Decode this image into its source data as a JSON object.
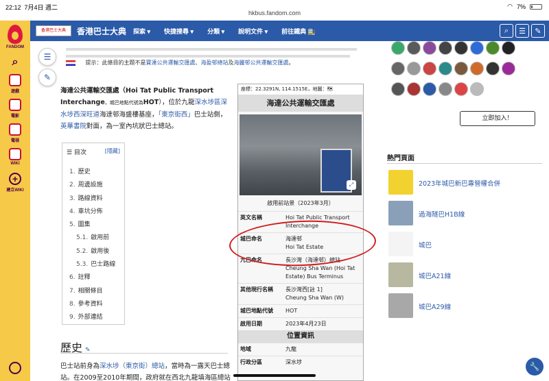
{
  "status": {
    "time": "22:12",
    "date": "7月4日 週二",
    "url": "hkbus.fandom.com",
    "battery": "7%"
  },
  "rail": {
    "brand": "FANDOM",
    "items": [
      {
        "label": "遊戲"
      },
      {
        "label": "電影"
      },
      {
        "label": "電視"
      },
      {
        "label": "WIKI"
      },
      {
        "label": "建立WIKI"
      }
    ]
  },
  "header": {
    "logo_text": "香港巴士大典",
    "title": "香港巴士大典",
    "nav": [
      "探索 ▾",
      "快捷搜尋 ▾",
      "分類 ▾",
      "說明文件 ▾",
      "前往鐵典 🚉"
    ]
  },
  "hatnote": {
    "prefix": "提示：此條目的主題不是",
    "link1": "寶達公共運輸交匯處",
    "mid1": "、",
    "link2": "海盈邨總站",
    "mid2": "及",
    "link3": "海麗邨公共運輸交匯處",
    "suffix": "。"
  },
  "intro": {
    "name": "海達公共運輸交匯處（Hoi Tat Public Transport Interchange",
    "code_label": "，城巴地點代號為",
    "code": "HOT",
    "text1": "），位於九龍",
    "link1": "深水埗區深水埗西深旺道",
    "text2": "海達邨海盛樓基座，",
    "link2": "「東京街西」",
    "text3": "巴士站側，",
    "link3": "英華書院",
    "text4": "對面，為一室內坑狀巴士總站。"
  },
  "toc": {
    "heading": "目次",
    "hide": "[隱藏]",
    "items": [
      {
        "n": "1.",
        "t": "歷史",
        "sub": false
      },
      {
        "n": "2.",
        "t": "周邊設施",
        "sub": false
      },
      {
        "n": "3.",
        "t": "路線資料",
        "sub": false
      },
      {
        "n": "4.",
        "t": "車坑分佈",
        "sub": false
      },
      {
        "n": "5.",
        "t": "圖集",
        "sub": false
      },
      {
        "n": "5.1.",
        "t": "啟用前",
        "sub": true
      },
      {
        "n": "5.2.",
        "t": "啟用後",
        "sub": true
      },
      {
        "n": "5.3.",
        "t": "巴士路線",
        "sub": true
      },
      {
        "n": "6.",
        "t": "註釋",
        "sub": false
      },
      {
        "n": "7.",
        "t": "相關條目",
        "sub": false
      },
      {
        "n": "8.",
        "t": "參考資料",
        "sub": false
      },
      {
        "n": "9.",
        "t": "外部連結",
        "sub": false
      }
    ]
  },
  "history": {
    "heading": "歷史",
    "text1": "巴士站前身為",
    "link1": "深水埗（東京街）總站",
    "text2": "，當時為一露天巴士總站。在2009至2010年期間，政府就在西北九龍填海區總站"
  },
  "infobox": {
    "coords": "座標：22.3291N, 114.1515E，地圖：",
    "title": "海達公共運輸交匯處",
    "caption": "啟用前站景（2023年3月）",
    "rows1": [
      {
        "k": "英文名稱",
        "v": "Hoi Tat Public Transport Interchange"
      },
      {
        "k": "城巴命名",
        "v": "海達邨\nHoi Tat Estate"
      },
      {
        "k": "九巴命名",
        "v": "長沙灣（海達邨）總站\nCheung Sha Wan (Hoi Tat Estate) Bus Terminus"
      },
      {
        "k": "其他現行名稱",
        "v": "長沙灣西[註 1]\nCheung Sha Wan (W)"
      },
      {
        "k": "城巴地點代號",
        "v": "HOT"
      },
      {
        "k": "啟用日期",
        "v": "2023年4月23日"
      }
    ],
    "section": "位置資訊",
    "rows2": [
      {
        "k": "地域",
        "v": "九龍"
      },
      {
        "k": "行政分區",
        "v": "深水埗"
      }
    ]
  },
  "sidebar": {
    "join": "立即加入！",
    "popular_heading": "熱門頁面",
    "popular": [
      {
        "label": "2023年城巴新巴專營權合併",
        "color": "#f2d22e"
      },
      {
        "label": "過海隧巴H1B線",
        "color": "#8aa0b8"
      },
      {
        "label": "城巴",
        "color": "#f4f4f4"
      },
      {
        "label": "城巴A21線",
        "color": "#b8b8a0"
      },
      {
        "label": "城巴A29線",
        "color": "#a8a8a8"
      }
    ],
    "avatar_colors": [
      "#3aa86b",
      "#5a5a5a",
      "#8a4b9c",
      "#444",
      "#333",
      "#2b6cd8",
      "#4a8a2a",
      "#222",
      "#666",
      "#999",
      "#c44",
      "#2a8a8a",
      "#7a5a3a",
      "#d06a2a",
      "#333",
      "#9a2a9a",
      "#555",
      "#a33",
      "#2a5aa8",
      "#888",
      "#d44",
      "#bbb"
    ]
  }
}
